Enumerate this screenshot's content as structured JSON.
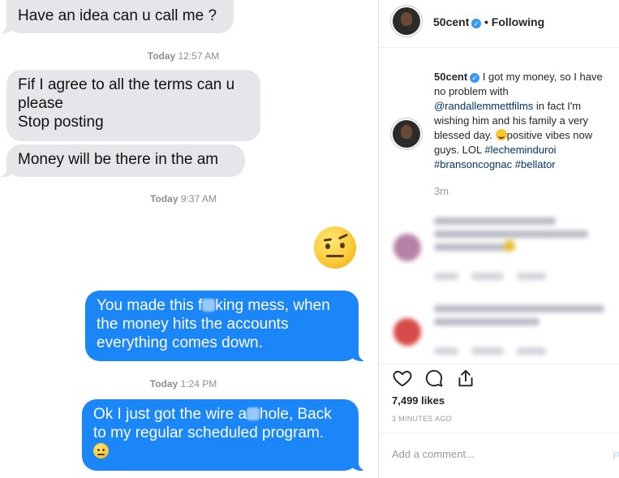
{
  "chat": {
    "messages": [
      {
        "from": "them",
        "lines": [
          "Have an idea can u call me ?"
        ]
      },
      {
        "timestamp_day": "Today",
        "timestamp_time": "12:57 AM"
      },
      {
        "from": "them",
        "lines": [
          "Fif I agree to all the terms can u",
          "please",
          "Stop posting"
        ]
      },
      {
        "from": "them",
        "lines": [
          "Money will be there in the am"
        ]
      },
      {
        "timestamp_day": "Today",
        "timestamp_time": "9:37 AM"
      },
      {
        "from": "me",
        "lines": [
          "You made this f",
          "king mess, when",
          "the money hits the accounts",
          "everything comes down."
        ]
      },
      {
        "timestamp_day": "Today",
        "timestamp_time": "1:24 PM"
      },
      {
        "from": "me",
        "lines": [
          "Ok I just got the wire a",
          "hole, Back",
          "to my regular scheduled program."
        ]
      }
    ]
  },
  "instagram": {
    "username": "50cent",
    "verified_mark": "✓",
    "separator": "•",
    "follow_status": "Following",
    "caption": {
      "text_1": "I got my money, so I have",
      "text_2": "no problem with",
      "mention": "@randallemmettfilms",
      "text_3": "in fact I'm",
      "text_4": "wishing him and his family a very",
      "text_5": "blessed day.",
      "text_6": "positive vibes now",
      "text_7": "guys. LOL",
      "tag_1": "#lecheminduroi",
      "tag_2": "#bransoncognac",
      "tag_3": "#bellator"
    },
    "posted_relative": "3m",
    "likes": "7,499 likes",
    "posted_ago": "3 MINUTES AGO",
    "comment_placeholder": "Add a comment...",
    "post_label": "P",
    "icons": {
      "like": "heart-icon",
      "comment": "comment-icon",
      "share": "share-icon"
    }
  },
  "colors": {
    "imessage_blue": "#1a86f8",
    "imessage_gray": "#e5e5ea",
    "ig_link": "#003569",
    "verified_blue": "#3897f0"
  }
}
